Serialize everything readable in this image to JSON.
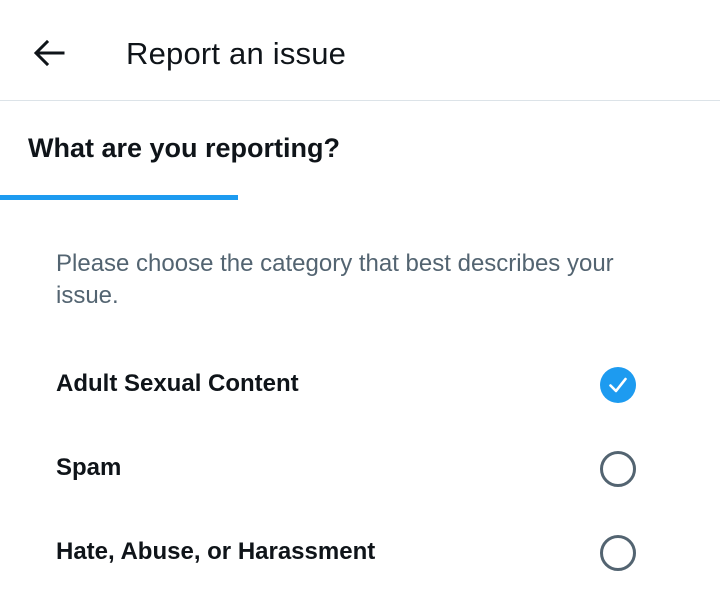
{
  "header": {
    "back_icon": "arrow-left-icon",
    "title": "Report an issue"
  },
  "tab": {
    "label": "What are you reporting?",
    "accent_color": "#1d9bf0"
  },
  "description": "Please choose the category that best describes your issue.",
  "options": [
    {
      "label": "Adult Sexual Content",
      "selected": true
    },
    {
      "label": "Spam",
      "selected": false
    },
    {
      "label": "Hate, Abuse, or Harassment",
      "selected": false
    }
  ],
  "colors": {
    "accent": "#1d9bf0",
    "text_primary": "#0f1419",
    "text_secondary": "#536471",
    "divider": "#dce3e8"
  }
}
